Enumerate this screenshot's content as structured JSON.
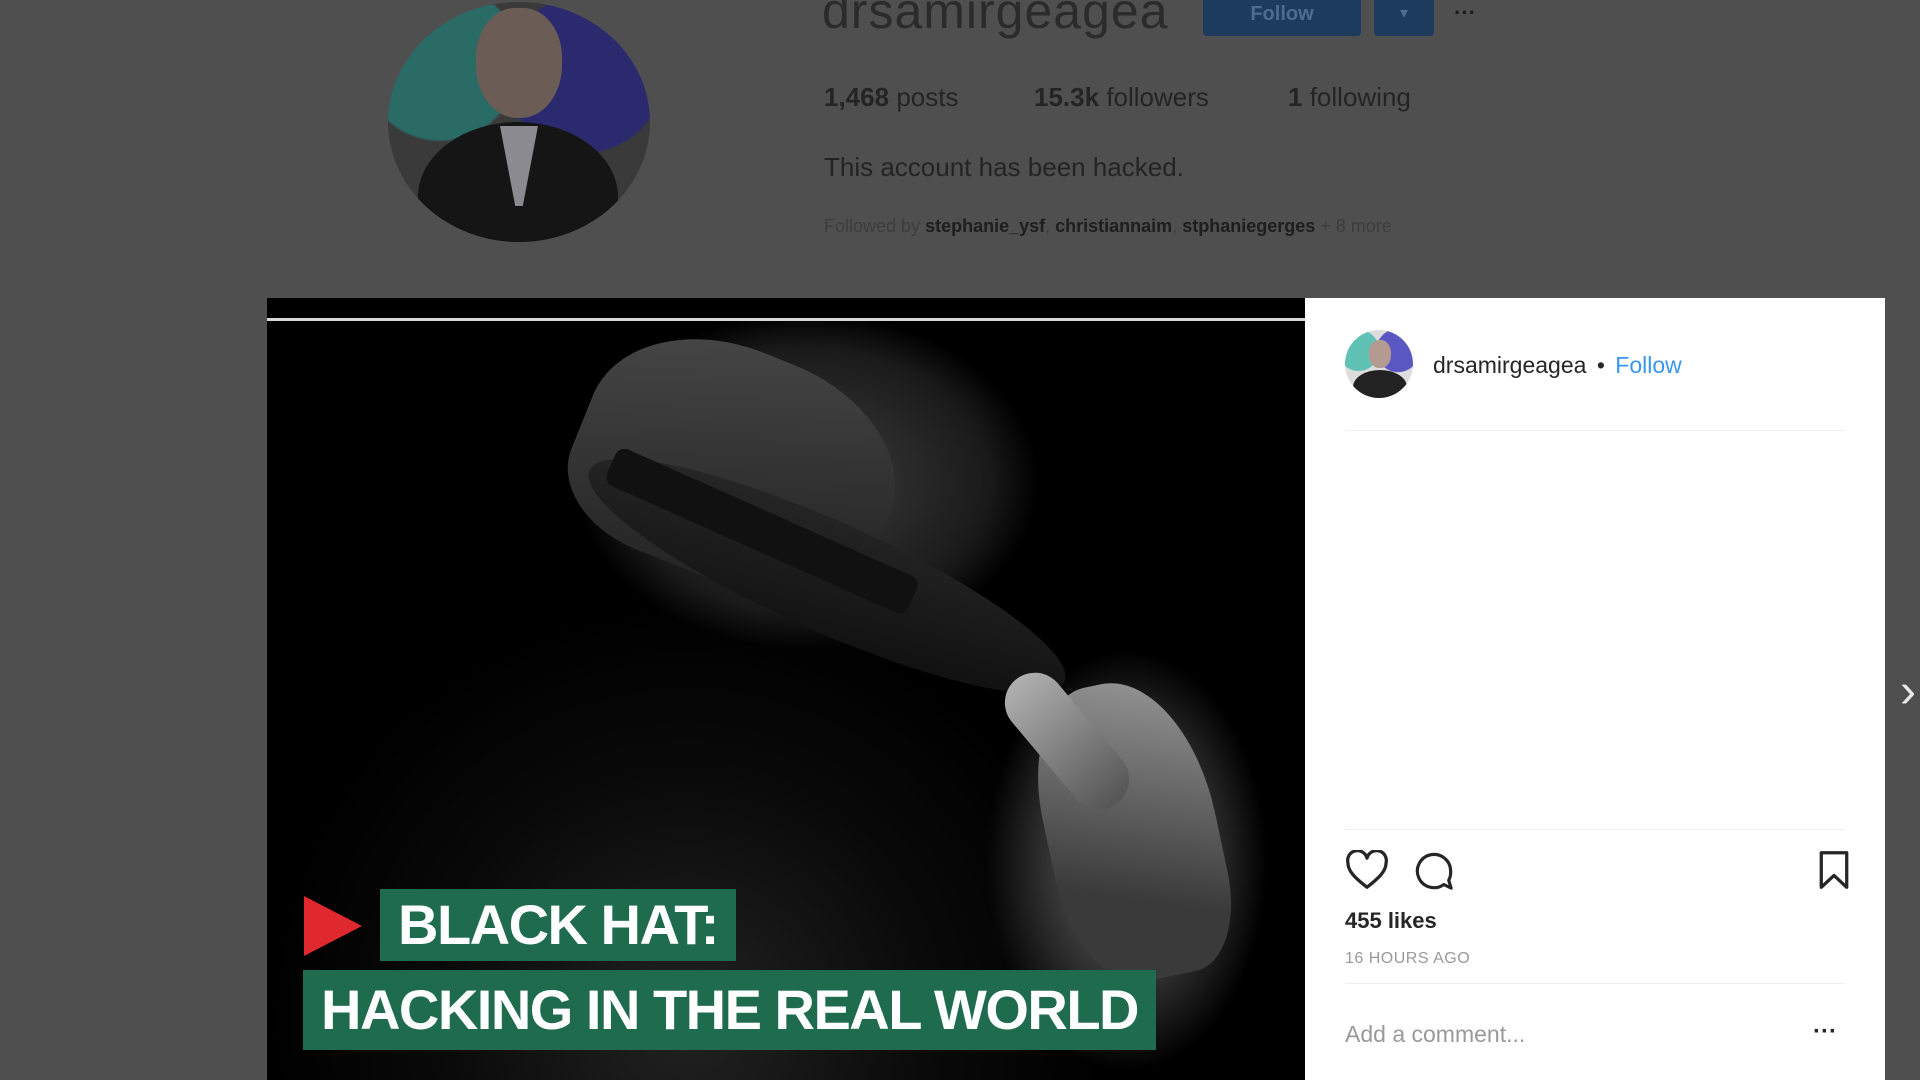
{
  "profile": {
    "username": "drsamirgeagea",
    "follow_label": "Follow",
    "dropdown_glyph": "▾",
    "more_glyph": "···",
    "stats": {
      "posts": "1,468",
      "posts_label": "posts",
      "followers": "15.3k",
      "followers_label": "followers",
      "following": "1",
      "following_label": "following"
    },
    "bio": "This account has been hacked.",
    "followed_by": {
      "prefix": "Followed by",
      "names": [
        "stephanie_ysf",
        "christiannaim",
        "stphaniegerges"
      ],
      "more": "+ 8 more"
    }
  },
  "post": {
    "media": {
      "banner_line1": "BLACK HAT:",
      "banner_line2": "HACKING IN THE REAL WORLD"
    },
    "header": {
      "username": "drsamirgeagea",
      "separator": "•",
      "follow_label": "Follow"
    },
    "likes": "455 likes",
    "time": "16 HOURS AGO",
    "comment_placeholder": "Add a comment...",
    "more_glyph": "···"
  },
  "navigation": {
    "next_glyph": "›"
  },
  "icons": [
    "heart-icon",
    "comment-icon",
    "bookmark-icon",
    "chevron-right-icon"
  ],
  "colors": {
    "follow_blue": "#3897f0",
    "banner_green": "#1f6b4d",
    "play_red": "#e0282f",
    "overlay_gray": "#4f4f4f"
  }
}
